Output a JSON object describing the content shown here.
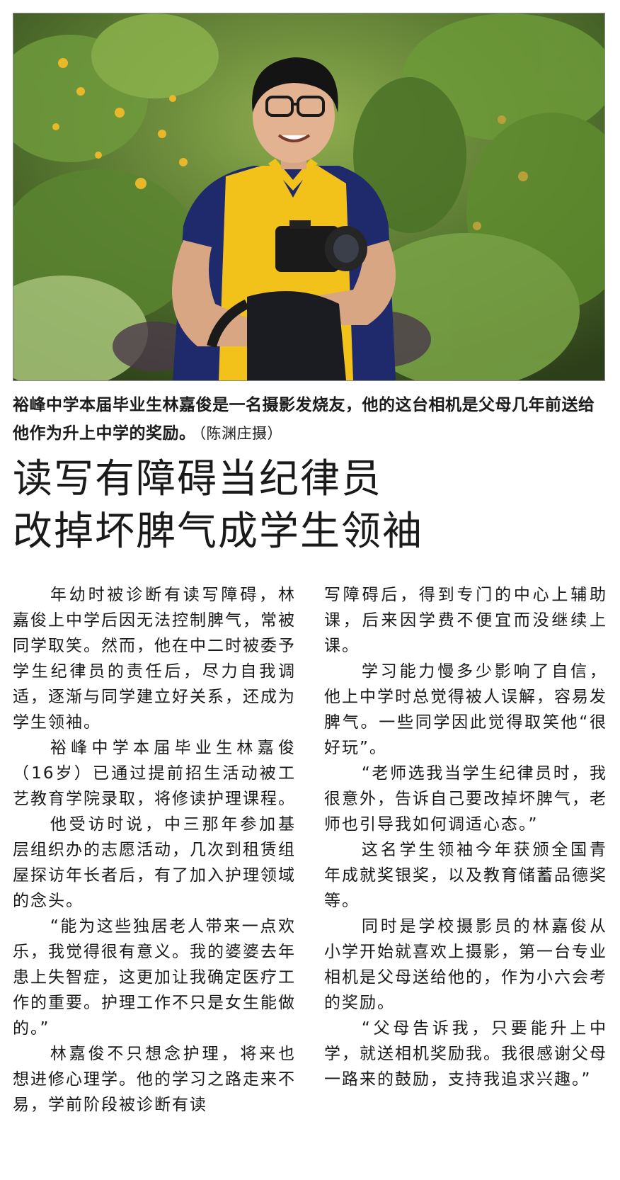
{
  "photo": {
    "alt": "photo-of-student-with-camera-in-garden"
  },
  "caption": {
    "text": "裕峰中学本届毕业生林嘉俊是一名摄影发烧友，他的这台相机是父母几年前送给他作为升上中学的奖励。",
    "credit": "（陈渊庄摄）"
  },
  "headline": {
    "line1": "读写有障碍当纪律员",
    "line2": "改掉坏脾气成学生领袖"
  },
  "article": {
    "col1": [
      "年幼时被诊断有读写障碍，林嘉俊上中学后因无法控制脾气，常被同学取笑。然而，他在中二时被委予学生纪律员的责任后，尽力自我调适，逐渐与同学建立好关系，还成为学生领袖。",
      "裕峰中学本届毕业生林嘉俊（16岁）已通过提前招生活动被工艺教育学院录取，将修读护理课程。",
      "他受访时说，中三那年参加基层组织办的志愿活动，几次到租赁组屋探访年长者后，有了加入护理领域的念头。",
      "“能为这些独居老人带来一点欢乐，我觉得很有意义。我的婆婆去年患上失智症，这更加让我确定医疗工作的重要。护理工作不只是女生能做的。”",
      "林嘉俊不只想念护理，将来也想进修心理学。他的学习之路走来不易，学前阶段被诊断有读"
    ],
    "col2": [
      "写障碍后，得到专门的中心上辅助课，后来因学费不便宜而没继续上课。",
      "学习能力慢多少影响了自信，他上中学时总觉得被人误解，容易发脾气。一些同学因此觉得取笑他“很好玩”。",
      "“老师选我当学生纪律员时，我很意外，告诉自己要改掉坏脾气，老师也引导我如何调适心态。”",
      "这名学生领袖今年获颁全国青年成就奖银奖，以及教育储蓄品德奖等。",
      "同时是学校摄影员的林嘉俊从小学开始就喜欢上摄影，第一台专业相机是父母送给他的，作为小六会考的奖励。",
      "“父母告诉我，只要能升上中学，就送相机奖励我。我很感谢父母一路来的鼓励，支持我追求兴趣。”"
    ]
  }
}
